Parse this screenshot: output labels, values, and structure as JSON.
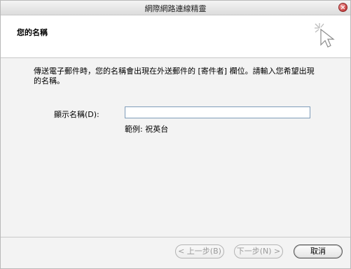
{
  "window": {
    "title": "網際網路連線精靈"
  },
  "header": {
    "title": "您的名稱"
  },
  "body": {
    "intro": "傳送電子郵件時，您的名稱會出現在外送郵件的 [寄件者] 欄位。請輸入您希望出現的名稱。",
    "display_name_label": "顯示名稱(D):",
    "display_name_value": "",
    "example": "範例: 祝英台"
  },
  "buttons": {
    "back": "< 上一步(B)",
    "next": "下一步(N) >",
    "cancel": "取消"
  }
}
